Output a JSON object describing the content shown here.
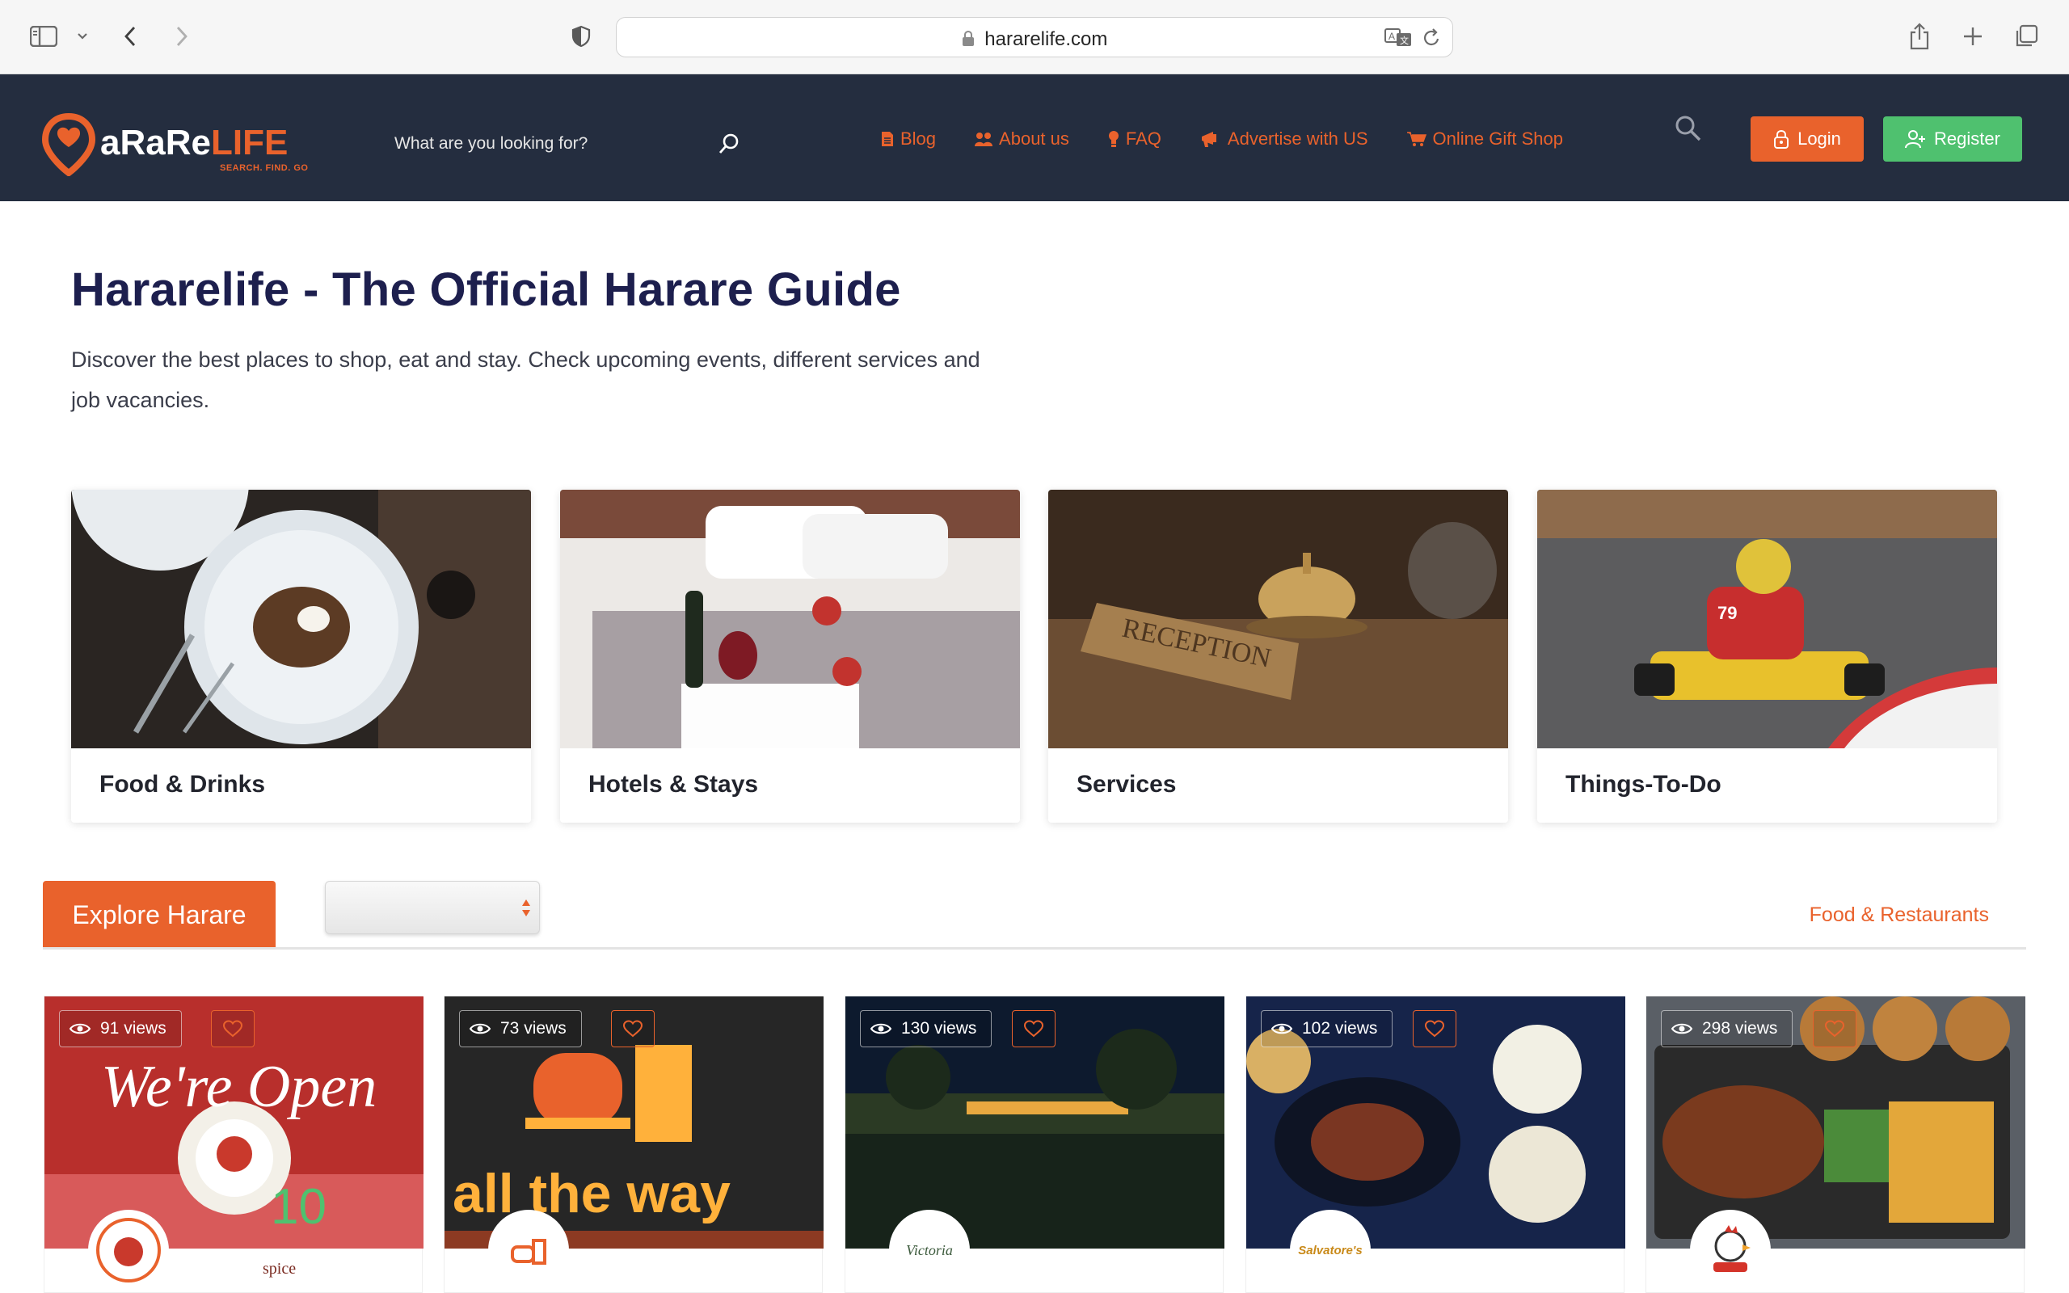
{
  "browser": {
    "url": "hararelife.com"
  },
  "header": {
    "logo_word_a": "aRaRe",
    "logo_word_b": "LIFE",
    "logo_tagline": "SEARCH. FIND. GO",
    "search_placeholder": "What are you looking for?",
    "nav": [
      {
        "label": "Blog",
        "icon": "document-icon"
      },
      {
        "label": "About us",
        "icon": "people-icon"
      },
      {
        "label": "FAQ",
        "icon": "lightbulb-icon"
      },
      {
        "label": "Advertise with US",
        "icon": "megaphone-icon"
      },
      {
        "label": "Online Gift Shop",
        "icon": "cart-icon"
      }
    ],
    "login_label": "Login",
    "register_label": "Register",
    "accent": "#e9622c",
    "green": "#4fc16f",
    "bg": "#242d3f"
  },
  "hero": {
    "title": "Hararelife - The Official Harare Guide",
    "description": "Discover the best places to shop, eat and stay. Check upcoming events, different services and job vacancies."
  },
  "categories": [
    {
      "label": "Food & Drinks"
    },
    {
      "label": "Hotels & Stays"
    },
    {
      "label": "Services"
    },
    {
      "label": "Things-To-Do"
    }
  ],
  "explore": {
    "tab_label": "Explore Harare",
    "category_link": "Food & Restaurants"
  },
  "listings": [
    {
      "views": "91 views",
      "banner_text": "We're Open",
      "logo_text": "spice",
      "rating": "10"
    },
    {
      "views": "73 views",
      "banner_text": "all the way",
      "logo_text": ""
    },
    {
      "views": "130 views",
      "logo_text": "Victoria"
    },
    {
      "views": "102 views",
      "logo_text": "Salvatore's"
    },
    {
      "views": "298 views",
      "logo_text": ""
    }
  ]
}
